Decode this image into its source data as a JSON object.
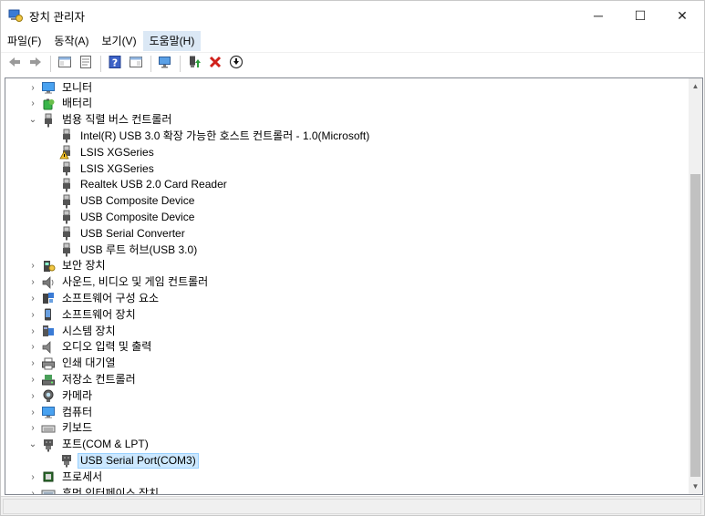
{
  "window": {
    "title": "장치 관리자",
    "min_glyph": "─",
    "max_glyph": "☐",
    "close_glyph": "✕"
  },
  "menu": [
    {
      "label": "파일(F)",
      "active": false
    },
    {
      "label": "동작(A)",
      "active": false
    },
    {
      "label": "보기(V)",
      "active": false
    },
    {
      "label": "도움말(H)",
      "active": true
    }
  ],
  "toolbar": [
    {
      "name": "back-button",
      "icon": "back-arrow-icon"
    },
    {
      "name": "forward-button",
      "icon": "forward-arrow-icon"
    },
    {
      "sep": true
    },
    {
      "name": "show-hide-tree-button",
      "icon": "console-tree-icon"
    },
    {
      "name": "properties-button",
      "icon": "properties-icon"
    },
    {
      "sep": true
    },
    {
      "name": "help-button",
      "icon": "help-icon"
    },
    {
      "name": "show-action-pane-button",
      "icon": "action-pane-icon"
    },
    {
      "sep": true
    },
    {
      "name": "scan-hardware-button",
      "icon": "monitor-scan-icon"
    },
    {
      "sep": true
    },
    {
      "name": "update-driver-button",
      "icon": "update-driver-icon"
    },
    {
      "name": "uninstall-device-button",
      "icon": "red-x-icon"
    },
    {
      "name": "disable-device-button",
      "icon": "down-arrow-circle-icon"
    }
  ],
  "tree": [
    {
      "level": 1,
      "arrow": "›",
      "icon": "monitor-icon",
      "label": "모니터"
    },
    {
      "level": 1,
      "arrow": "›",
      "icon": "battery-icon",
      "label": "배터리"
    },
    {
      "level": 1,
      "arrow": "⌄",
      "icon": "usb-plug-icon",
      "label": "범용 직렬 버스 컨트롤러"
    },
    {
      "level": 2,
      "arrow": "",
      "icon": "usb-plug-icon",
      "label": "Intel(R) USB 3.0 확장 가능한 호스트 컨트롤러 - 1.0(Microsoft)"
    },
    {
      "level": 2,
      "arrow": "",
      "icon": "usb-warning-icon",
      "label": "LSIS XGSeries"
    },
    {
      "level": 2,
      "arrow": "",
      "icon": "usb-plug-icon",
      "label": "LSIS XGSeries"
    },
    {
      "level": 2,
      "arrow": "",
      "icon": "usb-plug-icon",
      "label": "Realtek USB 2.0 Card Reader"
    },
    {
      "level": 2,
      "arrow": "",
      "icon": "usb-plug-icon",
      "label": "USB Composite Device"
    },
    {
      "level": 2,
      "arrow": "",
      "icon": "usb-plug-icon",
      "label": "USB Composite Device"
    },
    {
      "level": 2,
      "arrow": "",
      "icon": "usb-plug-icon",
      "label": "USB Serial Converter"
    },
    {
      "level": 2,
      "arrow": "",
      "icon": "usb-plug-icon",
      "label": "USB 루트 허브(USB 3.0)"
    },
    {
      "level": 1,
      "arrow": "›",
      "icon": "security-device-icon",
      "label": "보안 장치"
    },
    {
      "level": 1,
      "arrow": "›",
      "icon": "speaker-icon",
      "label": "사운드, 비디오 및 게임 컨트롤러"
    },
    {
      "level": 1,
      "arrow": "›",
      "icon": "software-component-icon",
      "label": "소프트웨어 구성 요소"
    },
    {
      "level": 1,
      "arrow": "›",
      "icon": "software-device-icon",
      "label": "소프트웨어 장치"
    },
    {
      "level": 1,
      "arrow": "›",
      "icon": "system-device-icon",
      "label": "시스템 장치"
    },
    {
      "level": 1,
      "arrow": "›",
      "icon": "audio-io-icon",
      "label": "오디오 입력 및 출력"
    },
    {
      "level": 1,
      "arrow": "›",
      "icon": "printer-icon",
      "label": "인쇄 대기열"
    },
    {
      "level": 1,
      "arrow": "›",
      "icon": "storage-controller-icon",
      "label": "저장소 컨트롤러"
    },
    {
      "level": 1,
      "arrow": "›",
      "icon": "camera-icon",
      "label": "카메라"
    },
    {
      "level": 1,
      "arrow": "›",
      "icon": "computer-icon",
      "label": "컴퓨터"
    },
    {
      "level": 1,
      "arrow": "›",
      "icon": "keyboard-icon",
      "label": "키보드"
    },
    {
      "level": 1,
      "arrow": "⌄",
      "icon": "port-icon",
      "label": "포트(COM & LPT)"
    },
    {
      "level": 2,
      "arrow": "",
      "icon": "port-icon",
      "label": "USB Serial Port(COM3)",
      "selected": true
    },
    {
      "level": 1,
      "arrow": "›",
      "icon": "processor-icon",
      "label": "프로세서"
    },
    {
      "level": 1,
      "arrow": "›",
      "icon": "hid-icon",
      "label": "휴먼 인터페이스 장치"
    }
  ],
  "scrollbar": {
    "up_glyph": "▲",
    "down_glyph": "▼",
    "position_fraction": 0.85
  }
}
